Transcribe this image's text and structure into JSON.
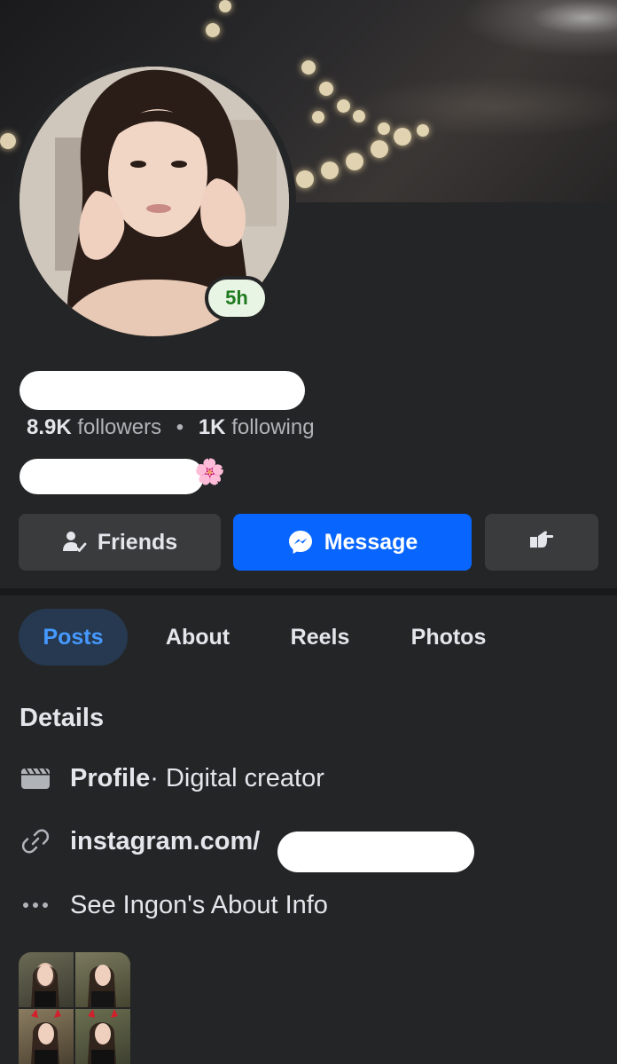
{
  "profile": {
    "story_badge": "5h",
    "followers_count": "8.9K",
    "followers_label": "followers",
    "following_count": "1K",
    "following_label": "following",
    "bio_emoji": "🌸"
  },
  "actions": {
    "friends_label": "Friends",
    "message_label": "Message"
  },
  "tabs": [
    {
      "label": "Posts",
      "active": true
    },
    {
      "label": "About",
      "active": false
    },
    {
      "label": "Reels",
      "active": false
    },
    {
      "label": "Photos",
      "active": false
    }
  ],
  "details": {
    "title": "Details",
    "category_bold": "Profile",
    "category_rest": " · Digital creator",
    "link_visible": "instagram.com/",
    "see_about": "See Ingon's About Info"
  },
  "colors": {
    "accent": "#0866ff",
    "tab_active_bg": "#263951",
    "tab_active_text": "#4599ff",
    "background": "#242526",
    "button_bg": "#3a3b3c"
  }
}
